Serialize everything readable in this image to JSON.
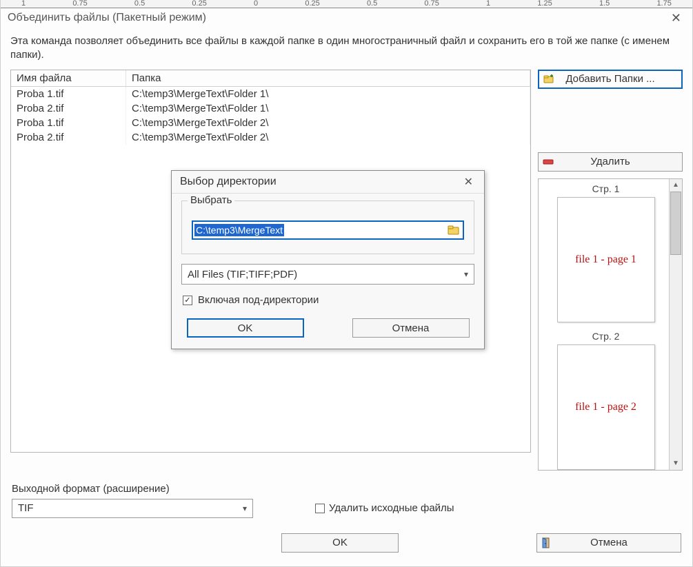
{
  "ruler": [
    "1",
    "0.75",
    "0.5",
    "0.25",
    "0",
    "0.25",
    "0.5",
    "0.75",
    "1",
    "1.25",
    "1.5",
    "1.75"
  ],
  "window": {
    "title": "Объединить файлы (Пакетный режим)",
    "description": "Эта команда позволяет объединить все файлы в каждой папке в один многостраничный файл и сохранить его в той же папке (с именем папки).",
    "close_x": "✕"
  },
  "table": {
    "headers": {
      "name": "Имя файла",
      "folder": "Папка"
    },
    "rows": [
      {
        "name": "Proba 1.tif",
        "folder": "C:\\temp3\\MergeText\\Folder 1\\"
      },
      {
        "name": "Proba 2.tif",
        "folder": "C:\\temp3\\MergeText\\Folder 1\\"
      },
      {
        "name": "Proba 1.tif",
        "folder": "C:\\temp3\\MergeText\\Folder 2\\"
      },
      {
        "name": "Proba 2.tif",
        "folder": "C:\\temp3\\MergeText\\Folder 2\\"
      }
    ]
  },
  "side": {
    "add_folders": "Добавить Папки ...",
    "delete": "Удалить"
  },
  "preview": {
    "pages": [
      {
        "label": "Стр. 1",
        "content": "file 1 - page 1"
      },
      {
        "label": "Стр. 2",
        "content": "file 1 - page 2"
      }
    ]
  },
  "bottom": {
    "format_label": "Выходной формат (расширение)",
    "format_value": "TIF",
    "delete_source": "Удалить исходные файлы",
    "ok": "OK",
    "cancel": "Отмена"
  },
  "modal": {
    "title": "Выбор директории",
    "close_x": "✕",
    "legend": "Выбрать",
    "path": "C:\\temp3\\MergeText",
    "filter": "All Files (TIF;TIFF;PDF)",
    "include_sub": "Включая под-директории",
    "ok": "OK",
    "cancel": "Отмена"
  }
}
